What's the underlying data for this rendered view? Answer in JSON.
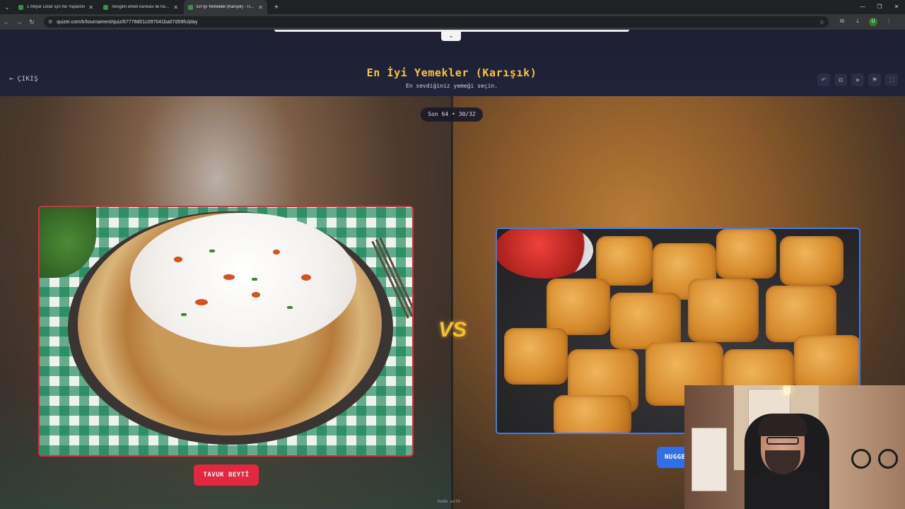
{
  "browser": {
    "tabs": [
      {
        "title": "1 Milyar Dolar için Ne Yapardın",
        "active": false
      },
      {
        "title": "Sevgilin erkek kankası ile hangi",
        "active": false
      },
      {
        "title": "En İyi Yemekler (Karışık) - Tier l",
        "active": true
      }
    ],
    "url": "quizei.com/tr/tournament/quiz/67778d01c097041ba07d59fc/play",
    "profile_initial": "U"
  },
  "header": {
    "exit_label": "ÇIKIŞ",
    "title": "En İyi Yemekler (Karışık)",
    "subtitle": "En sevdiğiniz yemeği seçin."
  },
  "tournament": {
    "round_label": "Son 64 • 30/32",
    "vs_label": "VS",
    "left_choice": "TAVUK BEYTİ",
    "right_choice": "NUGGETS"
  },
  "footer": {
    "made_with": "made with"
  },
  "colors": {
    "title": "#f5c542",
    "left_accent": "#e5263f",
    "right_accent": "#2f6fe8"
  }
}
